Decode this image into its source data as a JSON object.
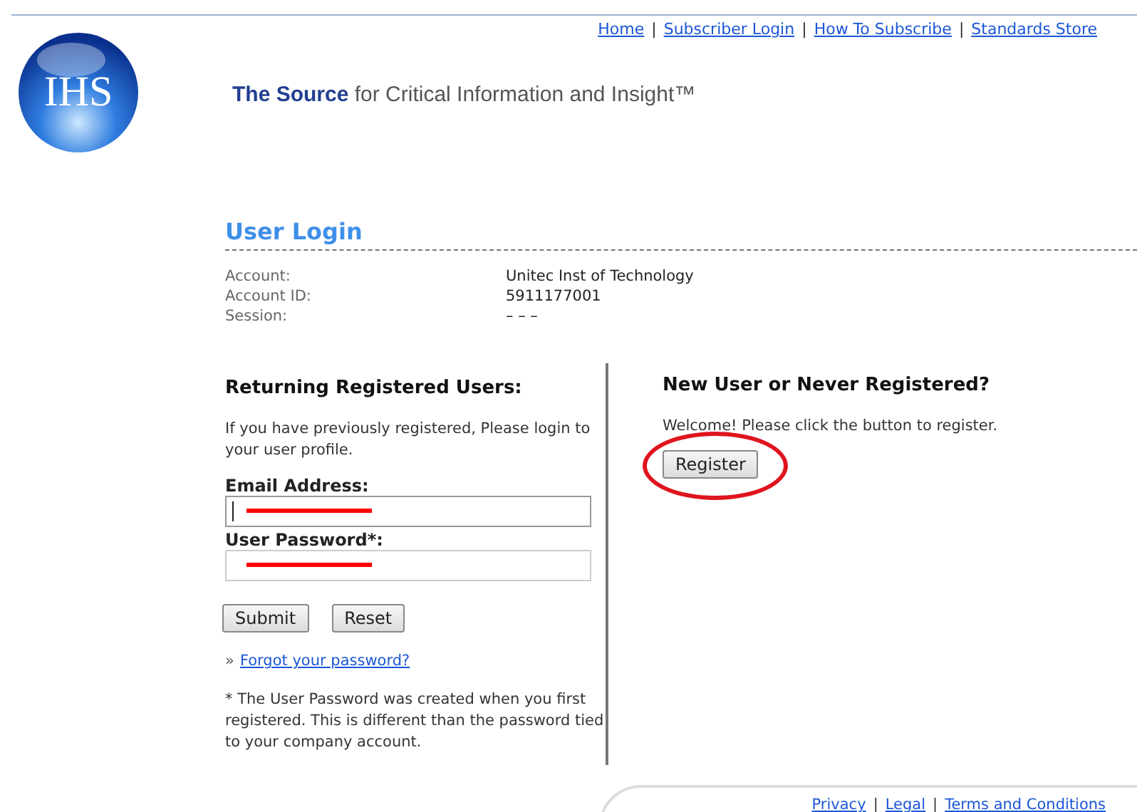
{
  "top_links": [
    "Home",
    "Subscriber Login",
    "How To Subscribe",
    "Standards Store"
  ],
  "link_separator": "|",
  "logo": {
    "text": "IHS"
  },
  "tagline": "**The Source** for Critical Information and Insight™",
  "title": "User Login",
  "account_info": [
    {
      "label": "Account:",
      "value": "Unitec Inst of Technology"
    },
    {
      "label": "Account ID:",
      "value": "5911177001"
    },
    {
      "label": "Session:",
      "value": "– – –"
    }
  ],
  "returning": {
    "heading": "Returning Registered Users:",
    "intro": "If you have previously registered, Please login to your user profile.",
    "fields": [
      {
        "label": "Email Address:",
        "redacted": true,
        "focused": true
      },
      {
        "label": "User Password*:",
        "redacted": true,
        "focused": false
      }
    ],
    "buttons": [
      "Submit",
      "Reset"
    ],
    "forgot_bullet": "»",
    "forgot_link": "Forgot your password?",
    "note": "* The User Password was created when you first registered. This is different than the password tied to your company account."
  },
  "new_user": {
    "heading": "New User or Never Registered?",
    "text": "Welcome! Please click the button to register.",
    "button": "Register",
    "circled": true
  },
  "footer_links": [
    "Privacy",
    "Legal",
    "Terms and Conditions"
  ]
}
